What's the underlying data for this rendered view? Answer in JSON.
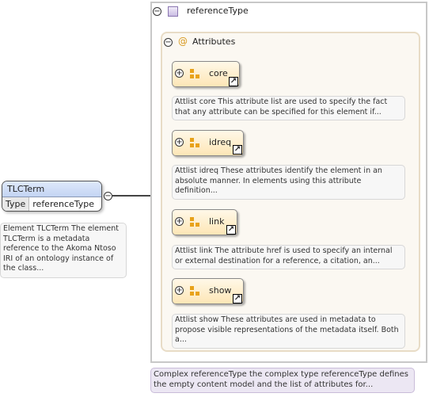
{
  "element": {
    "name": "TLCTerm",
    "type_key": "Type",
    "type_value": "referenceType",
    "documentation": "Element TLCTerm The element TLCTerm is a metadata reference to the Akoma Ntoso IRI of an ontology instance of the class..."
  },
  "complex_type": {
    "name": "referenceType",
    "documentation": "Complex referenceType the complex type referenceType defines the empty content model and the list of attributes for..."
  },
  "attributes_group": {
    "title": "Attributes",
    "at_symbol": "@",
    "items": [
      {
        "name": "core",
        "documentation": "Attlist core This attribute list are used to specify the fact that any attribute can be specified for this element if..."
      },
      {
        "name": "idreq",
        "documentation": "Attlist idreq These attributes identify the element in an absolute manner. In elements using this attribute definition..."
      },
      {
        "name": "link",
        "documentation": "Attlist link The attribute href is used to specify an internal or external destination for a reference, a citation, an..."
      },
      {
        "name": "show",
        "documentation": "Attlist show These attributes are used in metadata to propose visible representations of the metadata itself. Both a..."
      }
    ]
  },
  "symbols": {
    "collapse": "−",
    "expand": "+",
    "external": "↗"
  }
}
